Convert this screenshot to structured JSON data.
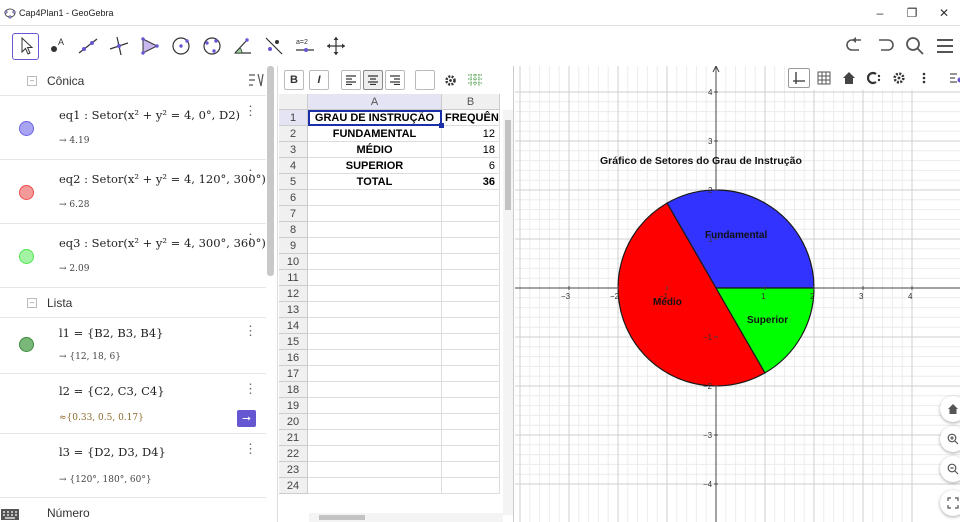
{
  "window": {
    "title": "Cap4Plan1 - GeoGebra",
    "controls": [
      "–",
      "❐",
      "✕"
    ]
  },
  "toolbar": {
    "tools": [
      "move-tool",
      "point-tool",
      "line-tool",
      "perpendicular-tool",
      "polygon-tool",
      "circle-tool",
      "conic-tool",
      "angle-tool",
      "reflect-tool",
      "slider-tool",
      "move-view-tool"
    ],
    "slider_label": "a=2",
    "right": [
      "undo",
      "redo",
      "search",
      "menu"
    ]
  },
  "algebra": {
    "sections": {
      "conica": "Cônica",
      "lista": "Lista",
      "numero": "Número"
    },
    "items": [
      {
        "name": "eq1",
        "definition": "eq1 : Setor(x² + y² = 4, 0°, D2)",
        "value": "→ 4.19",
        "color": "#6c62e8"
      },
      {
        "name": "eq2",
        "definition": "eq2 : Setor(x² + y² = 4, 120°, 300°)",
        "value": "→ 6.28",
        "color": "#ef4b4b"
      },
      {
        "name": "eq3",
        "definition": "eq3 : Setor(x² + y² = 4, 300°, 360°)",
        "value": "→ 2.09",
        "color": "#4ce84c"
      },
      {
        "name": "l1",
        "definition": "l1 = {B2, B3, B4}",
        "value": "→ {12, 18, 6}",
        "color": "#3a8a3a"
      },
      {
        "name": "l2",
        "definition": "l2 = {C2, C3, C4}",
        "value": "≈{0.33, 0.5, 0.17}",
        "color": ""
      },
      {
        "name": "l3",
        "definition": "l3 = {D2, D3, D4}",
        "value": "→ {120°, 180°, 60°}",
        "color": ""
      }
    ]
  },
  "spreadsheet": {
    "toolbar": [
      "B",
      "I",
      "align-left",
      "align-center",
      "align-right",
      "color",
      "settings",
      "grid"
    ],
    "columns": [
      "A",
      "B"
    ],
    "rows": [
      "1",
      "2",
      "3",
      "4",
      "5",
      "6",
      "7",
      "8",
      "9",
      "10",
      "11",
      "12",
      "13",
      "14",
      "15",
      "16",
      "17",
      "18",
      "19",
      "20",
      "21",
      "22",
      "23",
      "24"
    ],
    "cells": [
      [
        "GRAU DE INSTRUÇÃO",
        "FREQUÊN"
      ],
      [
        "FUNDAMENTAL",
        "12"
      ],
      [
        "MÉDIO",
        "18"
      ],
      [
        "SUPERIOR",
        "6"
      ],
      [
        "TOTAL",
        "36"
      ]
    ]
  },
  "graphics": {
    "chart_title": "Gráfico de Setores do Grau de Instrução",
    "x_ticks": [
      "−3",
      "−2",
      "−1",
      "1",
      "2",
      "3",
      "4"
    ],
    "y_ticks": [
      "4",
      "3",
      "2",
      "1",
      "−1",
      "−2",
      "−3",
      "−4"
    ],
    "x_tick_values": [
      -3,
      -2,
      -1,
      1,
      2,
      3,
      4
    ],
    "y_tick_values": [
      4,
      3,
      2,
      1,
      -1,
      -2,
      -3,
      -4
    ],
    "sectors": [
      {
        "label": "Fundamental",
        "start_deg": 0,
        "end_deg": 120,
        "radius": 2,
        "color": "#3333ff"
      },
      {
        "label": "Médio",
        "start_deg": 120,
        "end_deg": 300,
        "radius": 2,
        "color": "#ff0000"
      },
      {
        "label": "Superior",
        "start_deg": 300,
        "end_deg": 360,
        "radius": 2,
        "color": "#00ff00"
      }
    ],
    "toolbar": [
      "axes-toggle",
      "grid-toggle",
      "home",
      "cp",
      "settings",
      "more"
    ]
  },
  "chart_data": {
    "type": "pie",
    "title": "Gráfico de Setores do Grau de Instrução",
    "categories": [
      "Fundamental",
      "Médio",
      "Superior"
    ],
    "values": [
      12,
      18,
      6
    ],
    "colors": [
      "#3333ff",
      "#ff0000",
      "#00ff00"
    ]
  }
}
